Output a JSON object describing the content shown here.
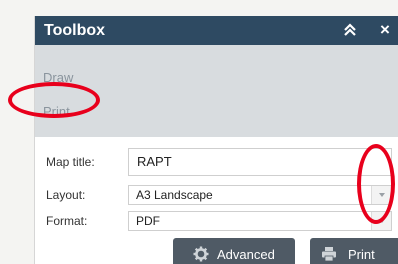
{
  "toolbox": {
    "title": "Toolbox",
    "collapse_icon": "double-chevron-up-icon",
    "close_label": "×"
  },
  "menu": {
    "items": [
      {
        "label": "Draw"
      },
      {
        "label": "Print"
      }
    ]
  },
  "form": {
    "map_title": {
      "label": "Map title:",
      "value": "RAPT"
    },
    "layout": {
      "label": "Layout:",
      "value": "A3 Landscape"
    },
    "format": {
      "label": "Format:",
      "value": "PDF"
    }
  },
  "buttons": {
    "advanced": {
      "label": "Advanced",
      "icon": "gear-icon"
    },
    "print": {
      "label": "Print",
      "icon": "printer-icon"
    }
  },
  "colors": {
    "titlebar": "#2e4a62",
    "menu_bg": "#d8dcdf",
    "button_bg": "#4f5a65",
    "annotation": "#e8001c"
  }
}
